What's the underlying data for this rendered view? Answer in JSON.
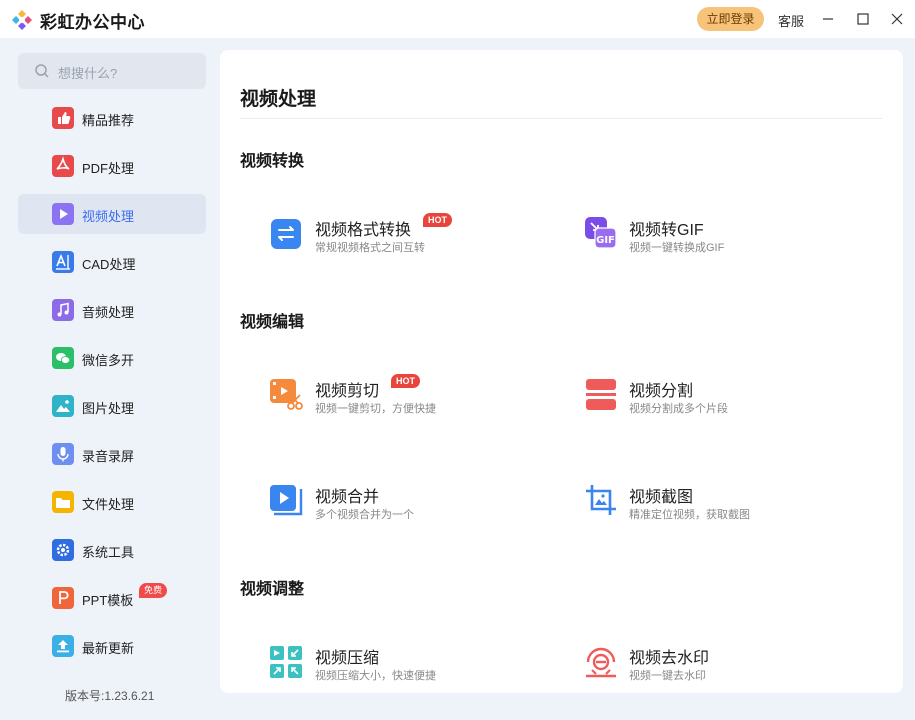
{
  "app": {
    "title": "彩虹办公中心",
    "login_label": "立即登录",
    "service_label": "客服"
  },
  "sidebar": {
    "search_placeholder": "想搜什么?",
    "items": [
      {
        "label": "精品推荐",
        "icon": "thumbs-up-icon",
        "color": "#e8494a"
      },
      {
        "label": "PDF处理",
        "icon": "pdf-icon",
        "color": "#e8494a"
      },
      {
        "label": "视频处理",
        "icon": "play-icon",
        "color": "#7b6cf0",
        "active": true
      },
      {
        "label": "CAD处理",
        "icon": "cad-icon",
        "color": "#3a7bea"
      },
      {
        "label": "音频处理",
        "icon": "music-icon",
        "color": "#8d6be8"
      },
      {
        "label": "微信多开",
        "icon": "wechat-icon",
        "color": "#2bbf6a"
      },
      {
        "label": "图片处理",
        "icon": "image-icon",
        "color": "#2fb3c8"
      },
      {
        "label": "录音录屏",
        "icon": "microphone-icon",
        "color": "#6f8ff0"
      },
      {
        "label": "文件处理",
        "icon": "folder-icon",
        "color": "#f5b400"
      },
      {
        "label": "系统工具",
        "icon": "gear-icon",
        "color": "#2f6de0"
      },
      {
        "label": "PPT模板",
        "icon": "ppt-icon",
        "color": "#f0663a",
        "badge": "免费"
      },
      {
        "label": "最新更新",
        "icon": "upload-icon",
        "color": "#3ab0e6"
      }
    ],
    "version": "版本号:1.23.6.21"
  },
  "main": {
    "title": "视频处理",
    "sections": [
      {
        "title": "视频转换",
        "tools": [
          {
            "name": "视频格式转换",
            "desc": "常规视频格式之间互转",
            "hot": "HOT",
            "icon": "convert-icon"
          },
          {
            "name": "视频转GIF",
            "desc": "视频一键转换成GIF",
            "icon": "gif-icon"
          }
        ]
      },
      {
        "title": "视频编辑",
        "tools": [
          {
            "name": "视频剪切",
            "desc": "视频一键剪切，方便快捷",
            "hot": "HOT",
            "icon": "scissors-icon"
          },
          {
            "name": "视频分割",
            "desc": "视频分割成多个片段",
            "icon": "split-icon"
          },
          {
            "name": "视频合并",
            "desc": "多个视频合并为一个",
            "icon": "merge-icon"
          },
          {
            "name": "视频截图",
            "desc": "精准定位视频，获取截图",
            "icon": "crop-icon"
          }
        ]
      },
      {
        "title": "视频调整",
        "tools": [
          {
            "name": "视频压缩",
            "desc": "视频压缩大小，快速便捷",
            "icon": "compress-icon"
          },
          {
            "name": "视频去水印",
            "desc": "视频一键去水印",
            "icon": "watermark-icon"
          }
        ]
      }
    ]
  }
}
